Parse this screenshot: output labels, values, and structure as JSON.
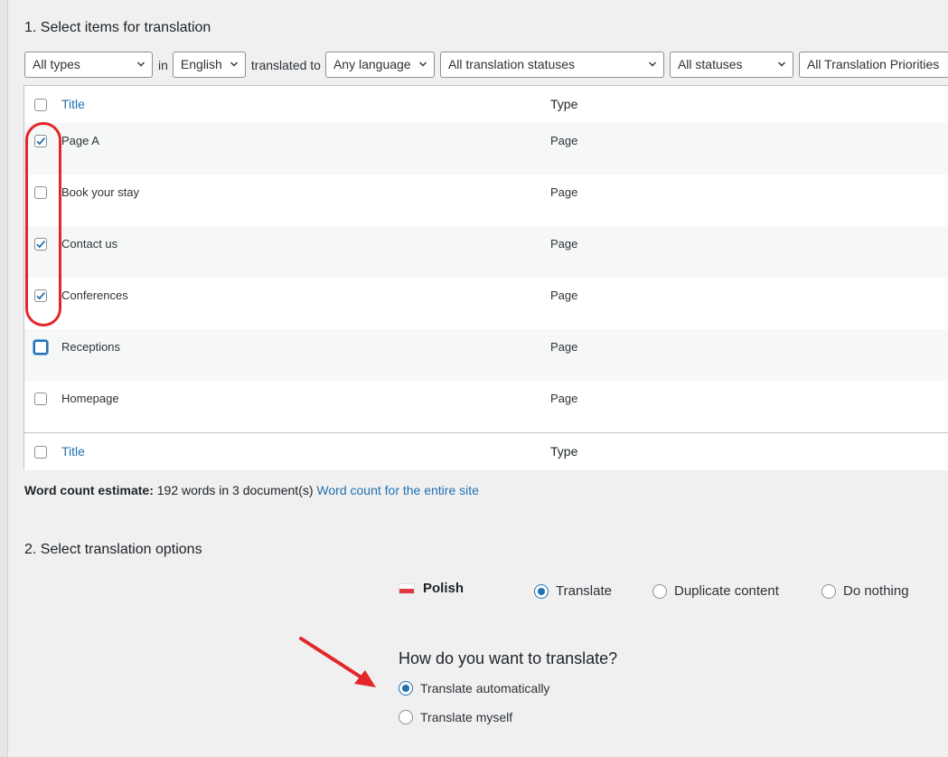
{
  "section1": {
    "title": "1. Select items for translation"
  },
  "filters": {
    "type": "All types",
    "in_label": "in",
    "source_lang": "English",
    "translated_to_label": "translated to",
    "target_lang": "Any language",
    "translation_status": "All translation statuses",
    "status": "All statuses",
    "priority": "All Translation Priorities"
  },
  "table": {
    "columns": [
      "Title",
      "Type"
    ],
    "rows": [
      {
        "title": "Page A",
        "type": "Page",
        "checked": true
      },
      {
        "title": "Book your stay",
        "type": "Page",
        "checked": false
      },
      {
        "title": "Contact us",
        "type": "Page",
        "checked": true
      },
      {
        "title": "Conferences",
        "type": "Page",
        "checked": true
      },
      {
        "title": "Receptions",
        "type": "Page",
        "checked": false
      },
      {
        "title": "Homepage",
        "type": "Page",
        "checked": false
      }
    ]
  },
  "word_count": {
    "label": "Word count estimate:",
    "value": "192 words in 3 document(s)",
    "link": "Word count for the entire site"
  },
  "section2": {
    "title": "2. Select translation options"
  },
  "language": {
    "name": "Polish",
    "options": [
      "Translate",
      "Duplicate content",
      "Do nothing"
    ],
    "selected": "Translate"
  },
  "method": {
    "question": "How do you want to translate?",
    "options": [
      "Translate automatically",
      "Translate myself"
    ],
    "selected": "Translate automatically"
  },
  "colors": {
    "accent": "#2271b1",
    "highlight": "#e3262a"
  }
}
